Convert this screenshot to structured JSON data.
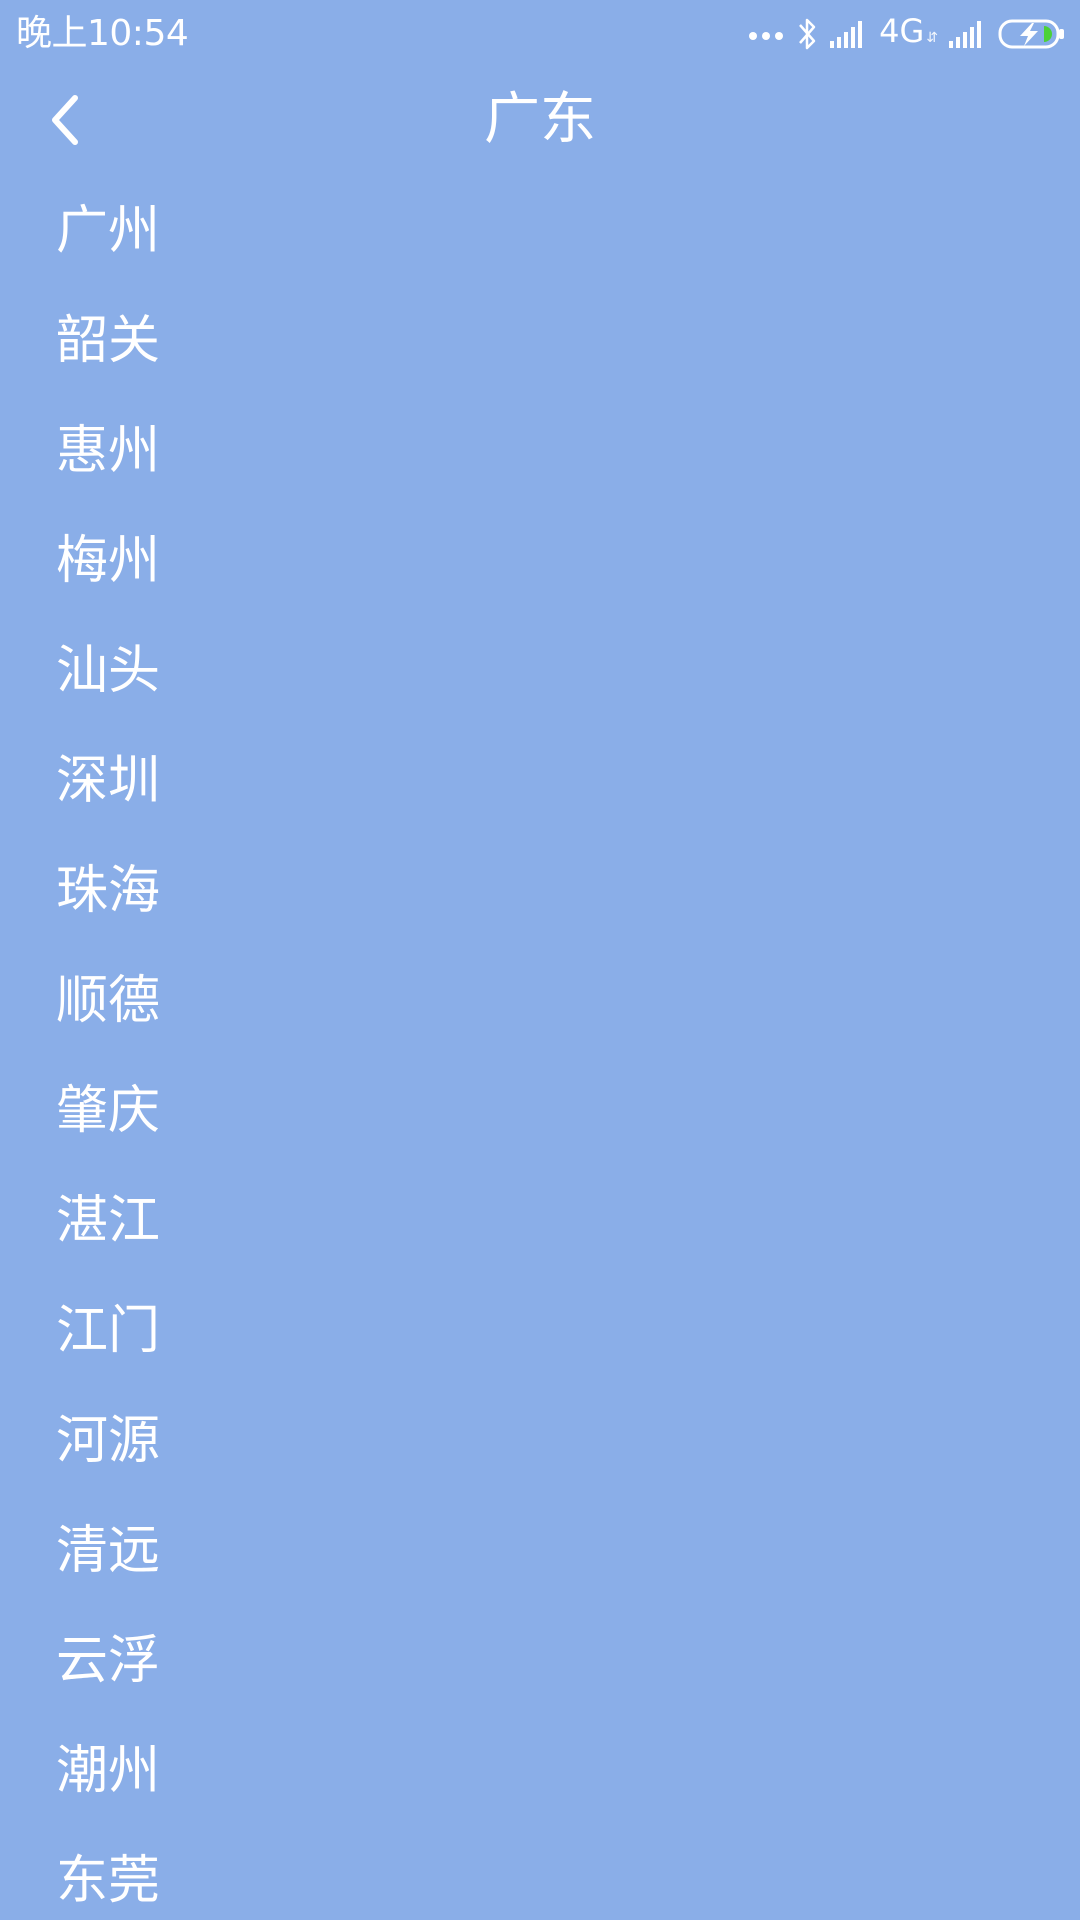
{
  "status_bar": {
    "time": "晚上10:54",
    "network": "4G",
    "network_activity": "⇵",
    "colors": {
      "battery_level": "#4cd137"
    },
    "icons": [
      "more-dots-icon",
      "bluetooth-icon",
      "signal-icon",
      "signal-icon",
      "battery-charging-icon"
    ]
  },
  "header": {
    "title": "广东",
    "back_icon": "chevron-left-icon"
  },
  "cities": [
    {
      "label": "广州"
    },
    {
      "label": "韶关"
    },
    {
      "label": "惠州"
    },
    {
      "label": "梅州"
    },
    {
      "label": "汕头"
    },
    {
      "label": "深圳"
    },
    {
      "label": "珠海"
    },
    {
      "label": "顺德"
    },
    {
      "label": "肇庆"
    },
    {
      "label": "湛江"
    },
    {
      "label": "江门"
    },
    {
      "label": "河源"
    },
    {
      "label": "清远"
    },
    {
      "label": "云浮"
    },
    {
      "label": "潮州"
    },
    {
      "label": "东莞"
    }
  ],
  "theme": {
    "background": "#8aaee8",
    "text": "#ffffff"
  }
}
